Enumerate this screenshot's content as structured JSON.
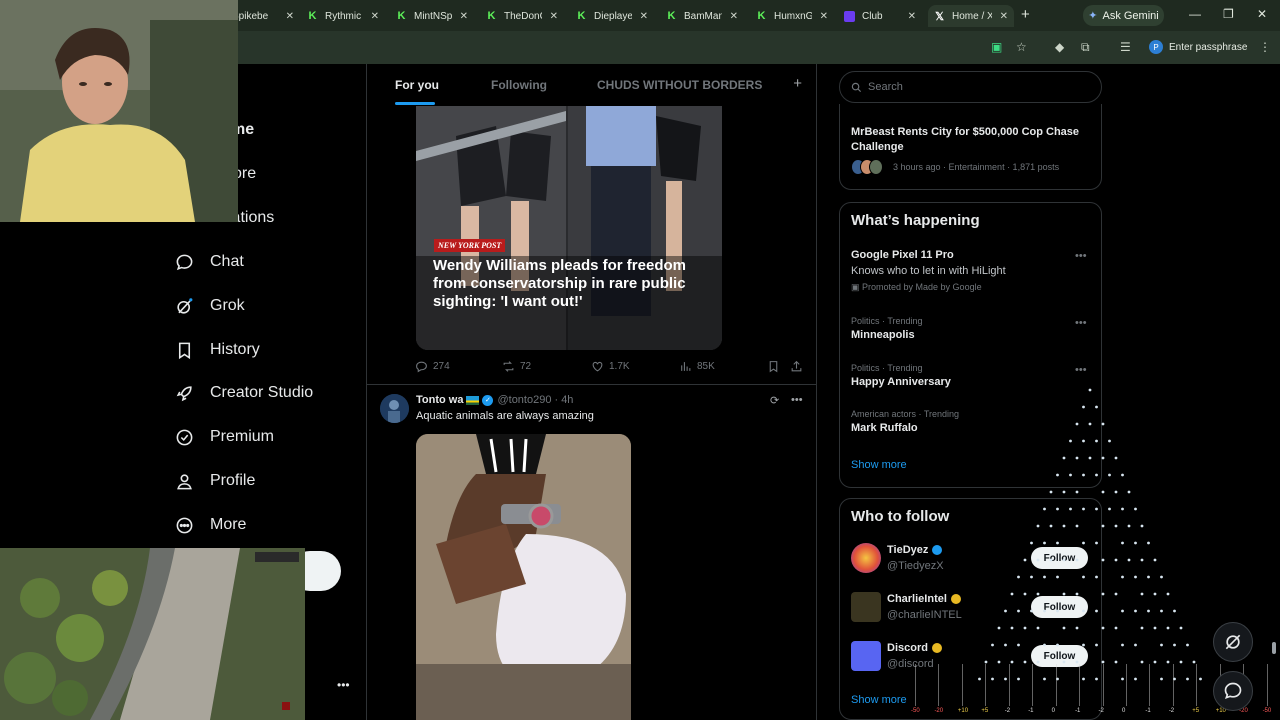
{
  "browser": {
    "tabs": [
      {
        "label": "Spikebeeo",
        "icon": "k-icon"
      },
      {
        "label": "Rythmic",
        "icon": "k-icon"
      },
      {
        "label": "MintNSp",
        "icon": "k-icon"
      },
      {
        "label": "TheDonC",
        "icon": "k-icon"
      },
      {
        "label": "Dieplaye",
        "icon": "k-icon"
      },
      {
        "label": "BamMan",
        "icon": "k-icon"
      },
      {
        "label": "HumxnG",
        "icon": "k-icon"
      },
      {
        "label": "Club",
        "icon": "club-icon"
      },
      {
        "label": "Home / X",
        "icon": "x-icon"
      }
    ],
    "gemini_label": "Ask Gemini",
    "passphrase_label": "Enter passphrase",
    "profile_initial": "P"
  },
  "nav": {
    "items": [
      {
        "label": "Home",
        "icon": "home-icon"
      },
      {
        "label": "Explore",
        "icon": "search-icon"
      },
      {
        "label": "Notifications",
        "icon": "bell-icon"
      },
      {
        "label": "Chat",
        "icon": "chat-icon"
      },
      {
        "label": "Grok",
        "icon": "grok-icon"
      },
      {
        "label": "History",
        "icon": "bookmark-icon"
      },
      {
        "label": "Creator Studio",
        "icon": "rocket-icon"
      },
      {
        "label": "Premium",
        "icon": "verified-icon"
      },
      {
        "label": "Profile",
        "icon": "person-icon"
      },
      {
        "label": "More",
        "icon": "more-circle-icon"
      }
    ],
    "visible_partial": {
      "home": "me",
      "explore": "ore",
      "notifications": "ifications"
    }
  },
  "feed": {
    "tabs": [
      "For you",
      "Following",
      "CHUDS WITHOUT BORDERS"
    ],
    "post1": {
      "source_badge": "NEW YORK POST",
      "headline": "Wendy Williams pleads for freedom from conservatorship in rare public sighting: 'I want out!'",
      "replies": "274",
      "reposts": "72",
      "likes": "1.7K",
      "views": "85K"
    },
    "post2": {
      "name": "Tonto wa",
      "handle": "@tonto290",
      "time": "· 4h",
      "text": "Aquatic animals are always amazing"
    }
  },
  "sidebar": {
    "search_placeholder": "Search",
    "news": {
      "title": "MrBeast Rents City for $500,000 Cop Chase Challenge",
      "meta": "3 hours ago · Entertainment · 1,871 posts"
    },
    "whats_happening": {
      "title": "What’s happening",
      "trends": [
        {
          "name": "Google Pixel 11 Pro",
          "sub": "Knows who to let in with HiLight",
          "promo": "Promoted by Made by Google"
        },
        {
          "cat": "Politics · Trending",
          "name": "Minneapolis"
        },
        {
          "cat": "Politics · Trending",
          "name": "Happy Anniversary"
        },
        {
          "cat": "American actors · Trending",
          "name": "Mark Ruffalo"
        }
      ],
      "show_more": "Show more"
    },
    "who_to_follow": {
      "title": "Who to follow",
      "accounts": [
        {
          "name": "TieDyez",
          "handle": "@TiedyezX",
          "follow": "Follow"
        },
        {
          "name": "CharlieIntel",
          "handle": "@charlieINTEL",
          "follow": "Follow"
        },
        {
          "name": "Discord",
          "handle": "@discord",
          "follow": "Follow"
        }
      ],
      "show_more": "Show more"
    }
  },
  "equalizer": [
    "-50",
    "-20",
    "+10",
    "+5",
    "-2",
    "-1",
    "0",
    "-1",
    "-2",
    "0",
    "-1",
    "-2",
    "+5",
    "+10",
    "-20",
    "-50"
  ],
  "colors": {
    "accent": "#1d9bf0",
    "bg": "#000000",
    "border": "#2f3336",
    "muted": "#71767b"
  }
}
